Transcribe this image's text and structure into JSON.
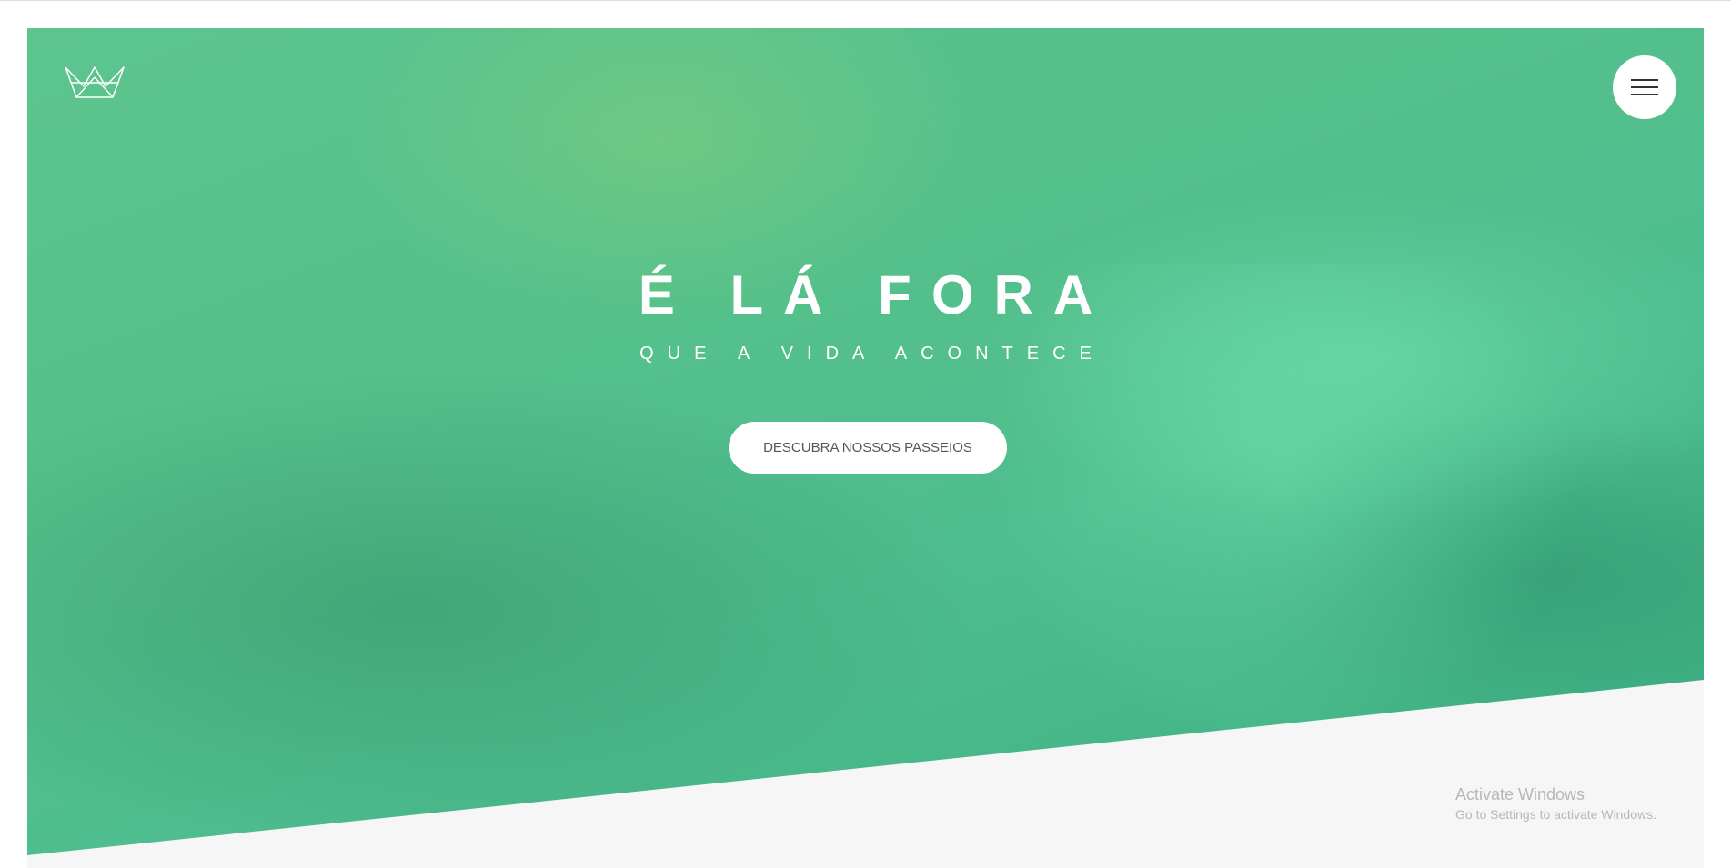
{
  "header": {
    "logo_icon": "crown-icon",
    "menu_icon": "hamburger-icon"
  },
  "hero": {
    "title": "É LÁ FORA",
    "subtitle": "QUE A VIDA ACONTECE",
    "cta_label": "DESCUBRA NOSSOS PASSEIOS"
  },
  "watermark": {
    "title": "Activate Windows",
    "subtitle": "Go to Settings to activate Windows."
  },
  "colors": {
    "hero_overlay": "#55c08a",
    "page_background": "#f6f6f6",
    "button_background": "#ffffff",
    "button_text": "#555555"
  }
}
